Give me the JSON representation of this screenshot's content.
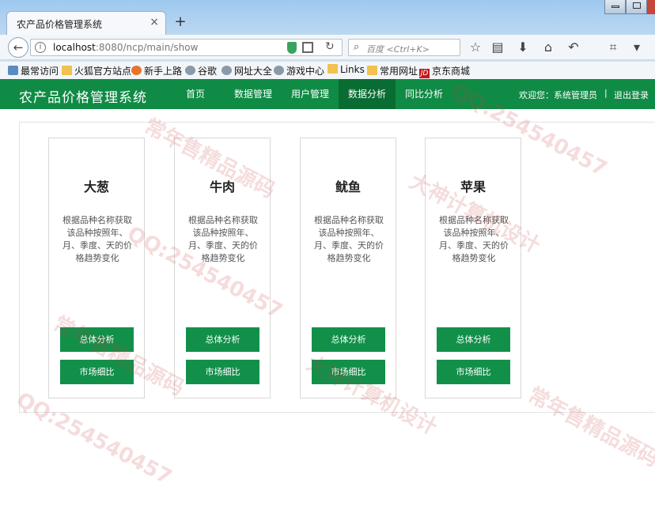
{
  "browser": {
    "tab_title": "农产品价格管理系统",
    "tab_close": "×",
    "new_tab": "+",
    "url_host": "localhost",
    "url_path": ":8080/ncp/main/show",
    "search_placeholder": "百度 <Ctrl+K>",
    "bookmarks": [
      "最常访问",
      "火狐官方站点",
      "新手上路",
      "谷歌",
      "网址大全",
      "游戏中心",
      "Links",
      "常用网址",
      "京东商城"
    ]
  },
  "app": {
    "title": "农产品价格管理系统",
    "menu": [
      {
        "label": "首页",
        "active": false
      },
      {
        "label": "数据管理",
        "active": false
      },
      {
        "label": "用户管理",
        "active": false
      },
      {
        "label": "数据分析",
        "active": true
      },
      {
        "label": "同比分析",
        "active": false
      }
    ],
    "welcome": "欢迎您：系统管理员",
    "separator": "|",
    "logout": "退出登录"
  },
  "cards": [
    {
      "title": "大葱",
      "desc": "根据品种名称获取该品种按照年、月、季度、天的价格趋势变化",
      "btn_total": "总体分析",
      "btn_market": "市场细比"
    },
    {
      "title": "牛肉",
      "desc": "根据品种名称获取该品种按照年、月、季度、天的价格趋势变化",
      "btn_total": "总体分析",
      "btn_market": "市场细比"
    },
    {
      "title": "鱿鱼",
      "desc": "根据品种名称获取该品种按照年、月、季度、天的价格趋势变化",
      "btn_total": "总体分析",
      "btn_market": "市场细比"
    },
    {
      "title": "苹果",
      "desc": "根据品种名称获取该品种按照年、月、季度、天的价格趋势变化",
      "btn_total": "总体分析",
      "btn_market": "市场细比"
    }
  ],
  "watermarks": [
    "常年售精品源码",
    "QQ:254540457",
    "大神计算机设计",
    "QQ:254540457",
    "常年售精品源码",
    "大神计算机设计",
    "QQ:254540457",
    "常年售精品源码"
  ],
  "colors": {
    "nav_green": "#0f8b45",
    "nav_active": "#096d33",
    "button_green": "#12904a"
  }
}
